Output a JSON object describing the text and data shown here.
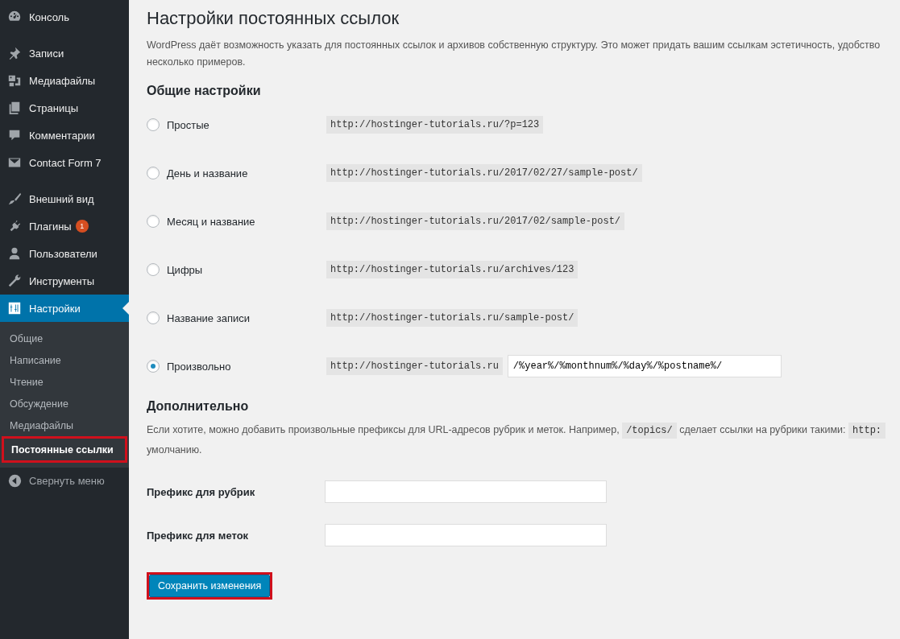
{
  "sidebar": {
    "menu_groups": [
      [
        {
          "label": "Консоль",
          "current": false
        }
      ],
      [
        {
          "label": "Записи",
          "current": false
        },
        {
          "label": "Медиафайлы",
          "current": false
        },
        {
          "label": "Страницы",
          "current": false
        },
        {
          "label": "Комментарии",
          "current": false
        },
        {
          "label": "Contact Form 7",
          "current": false
        }
      ],
      [
        {
          "label": "Внешний вид",
          "current": false
        },
        {
          "label": "Плагины",
          "current": false,
          "badge": "1"
        },
        {
          "label": "Пользователи",
          "current": false
        },
        {
          "label": "Инструменты",
          "current": false
        },
        {
          "label": "Настройки",
          "current": true
        }
      ]
    ],
    "submenu": [
      {
        "label": "Общие",
        "selected": false,
        "highlighted": false
      },
      {
        "label": "Написание",
        "selected": false,
        "highlighted": false
      },
      {
        "label": "Чтение",
        "selected": false,
        "highlighted": false
      },
      {
        "label": "Обсуждение",
        "selected": false,
        "highlighted": false
      },
      {
        "label": "Медиафайлы",
        "selected": false,
        "highlighted": false
      },
      {
        "label": "Постоянные ссылки",
        "selected": true,
        "highlighted": true
      }
    ],
    "collapse": "Свернуть меню"
  },
  "page_title": "Настройки постоянных ссылок",
  "intro_lines": [
    "WordPress даёт возможность указать для постоянных ссылок и архивов собственную структуру. Это может придать вашим ссылкам эстетичность, удобство",
    "несколько примеров."
  ],
  "common_heading": "Общие настройки",
  "structures": [
    {
      "label": "Простые",
      "example": "http://hostinger-tutorials.ru/?p=123",
      "selected": false
    },
    {
      "label": "День и название",
      "example": "http://hostinger-tutorials.ru/2017/02/27/sample-post/",
      "selected": false
    },
    {
      "label": "Месяц и название",
      "example": "http://hostinger-tutorials.ru/2017/02/sample-post/",
      "selected": false
    },
    {
      "label": "Цифры",
      "example": "http://hostinger-tutorials.ru/archives/123",
      "selected": false
    },
    {
      "label": "Название записи",
      "example": "http://hostinger-tutorials.ru/sample-post/",
      "selected": false
    },
    {
      "label": "Произвольно",
      "example": "http://hostinger-tutorials.ru",
      "selected": true,
      "value": "/%year%/%monthnum%/%day%/%postname%/"
    }
  ],
  "optional_heading": "Дополнительно",
  "optional_text": [
    {
      "kind": "text",
      "text": "Если хотите, можно добавить произвольные префиксы для URL-адресов рубрик и меток. Например,"
    },
    {
      "kind": "code",
      "text": "/topics/"
    },
    {
      "kind": "text",
      "text": "сделает ссылки на рубрики такими:"
    },
    {
      "kind": "code",
      "text": "http:"
    },
    {
      "kind": "break"
    },
    {
      "kind": "text",
      "text": "умолчанию."
    }
  ],
  "prefix_fields": [
    {
      "label": "Префикс для рубрик"
    },
    {
      "label": "Префикс для меток"
    }
  ],
  "save_button": {
    "label": "Сохранить изменения",
    "highlighted": true
  }
}
